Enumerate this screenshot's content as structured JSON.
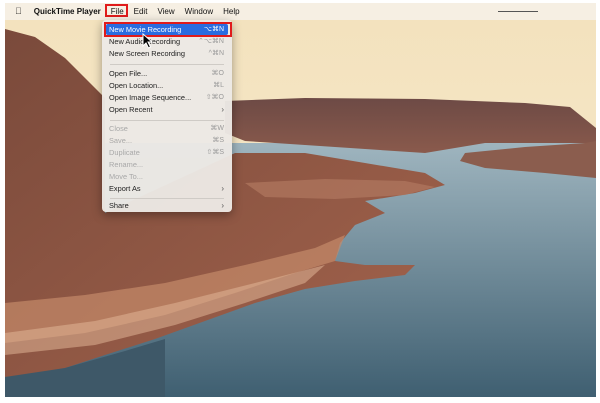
{
  "menubar": {
    "apple_icon": "apple-icon",
    "app_name": "QuickTime Player",
    "items": [
      "File",
      "Edit",
      "View",
      "Window",
      "Help"
    ]
  },
  "file_menu": {
    "items": [
      {
        "label": "New Movie Recording",
        "shortcut": "⌥⌘N",
        "state": "selected"
      },
      {
        "label": "New Audio Recording",
        "shortcut": "⌃⌥⌘N",
        "state": "enabled"
      },
      {
        "label": "New Screen Recording",
        "shortcut": "^⌘N",
        "state": "enabled"
      },
      {
        "label": "Open File...",
        "shortcut": "⌘O",
        "state": "enabled"
      },
      {
        "label": "Open Location...",
        "shortcut": "⌘L",
        "state": "enabled"
      },
      {
        "label": "Open Image Sequence...",
        "shortcut": "⇧⌘O",
        "state": "enabled"
      },
      {
        "label": "Open Recent",
        "submenu": true,
        "state": "enabled"
      },
      {
        "label": "Close",
        "shortcut": "⌘W",
        "state": "disabled"
      },
      {
        "label": "Save...",
        "shortcut": "⌘S",
        "state": "disabled"
      },
      {
        "label": "Duplicate",
        "shortcut": "⇧⌘S",
        "state": "disabled"
      },
      {
        "label": "Rename...",
        "state": "disabled"
      },
      {
        "label": "Move To...",
        "state": "disabled"
      },
      {
        "label": "Export As",
        "submenu": true,
        "state": "enabled"
      },
      {
        "label": "Share",
        "submenu": true,
        "state": "enabled"
      }
    ]
  },
  "highlight_color": "#e01b1b",
  "selection_color": "#2a6ce0"
}
